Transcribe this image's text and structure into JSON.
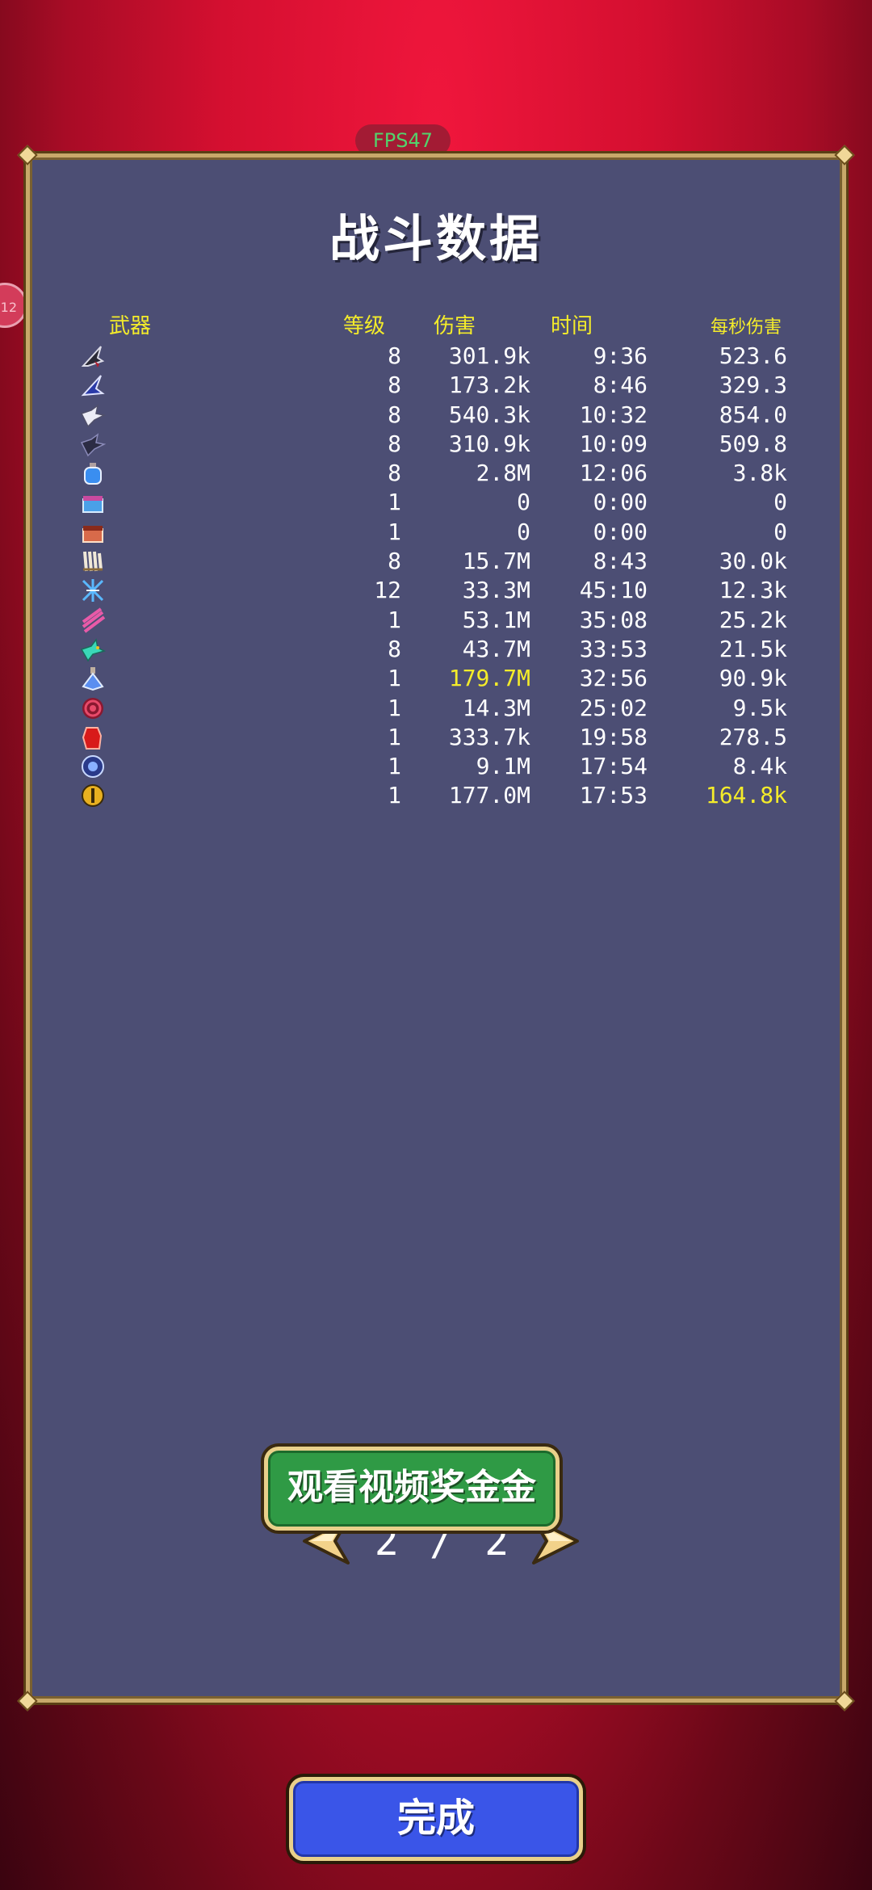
{
  "overlay": {
    "fps": "FPS47",
    "side_badge": "12"
  },
  "panel": {
    "title": "战斗数据",
    "headers": {
      "weapon": "武器",
      "level": "等级",
      "damage": "伤害",
      "time": "时间",
      "dps": "每秒伤害"
    },
    "rows": [
      {
        "icon": "dark-wing-icon",
        "level": "8",
        "damage": "301.9k",
        "time": "9:36",
        "dps": "523.6"
      },
      {
        "icon": "blue-wing-icon",
        "level": "8",
        "damage": "173.2k",
        "time": "8:46",
        "dps": "329.3"
      },
      {
        "icon": "white-bird-icon",
        "level": "8",
        "damage": "540.3k",
        "time": "10:32",
        "dps": "854.0"
      },
      {
        "icon": "dark-bird-icon",
        "level": "8",
        "damage": "310.9k",
        "time": "10:09",
        "dps": "509.8"
      },
      {
        "icon": "blue-potion-icon",
        "level": "8",
        "damage": "2.8M",
        "time": "12:06",
        "dps": "3.8k"
      },
      {
        "icon": "blue-chest-icon",
        "level": "1",
        "damage": "0",
        "time": "0:00",
        "dps": "0"
      },
      {
        "icon": "red-chest-icon",
        "level": "1",
        "damage": "0",
        "time": "0:00",
        "dps": "0"
      },
      {
        "icon": "claw-icon",
        "level": "8",
        "damage": "15.7M",
        "time": "8:43",
        "dps": "30.0k"
      },
      {
        "icon": "lightning-icon",
        "level": "12",
        "damage": "33.3M",
        "time": "45:10",
        "dps": "12.3k"
      },
      {
        "icon": "pink-slash-icon",
        "level": "1",
        "damage": "53.1M",
        "time": "35:08",
        "dps": "25.2k"
      },
      {
        "icon": "teal-bird-icon",
        "level": "8",
        "damage": "43.7M",
        "time": "33:53",
        "dps": "21.5k"
      },
      {
        "icon": "blue-flask-icon",
        "level": "1",
        "damage": "179.7M",
        "time": "32:56",
        "dps": "90.9k",
        "damage_highlight": true
      },
      {
        "icon": "red-spiral-icon",
        "level": "1",
        "damage": "14.3M",
        "time": "25:02",
        "dps": "9.5k"
      },
      {
        "icon": "red-glove-icon",
        "level": "1",
        "damage": "333.7k",
        "time": "19:58",
        "dps": "278.5"
      },
      {
        "icon": "blue-orb-icon",
        "level": "1",
        "damage": "9.1M",
        "time": "17:54",
        "dps": "8.4k"
      },
      {
        "icon": "gold-coin-icon",
        "level": "1",
        "damage": "177.0M",
        "time": "17:53",
        "dps": "164.8k",
        "dps_highlight": true
      }
    ],
    "pager": {
      "text": "2 / 2"
    },
    "watch_button": "观看视频奖金金"
  },
  "done_button": "完成",
  "colors": {
    "panel_bg": "#4c4e74",
    "highlight": "#f4ec2a",
    "watch_btn": "#2f9a45",
    "done_btn": "#3a55e8",
    "frame": "#c8a86a"
  }
}
